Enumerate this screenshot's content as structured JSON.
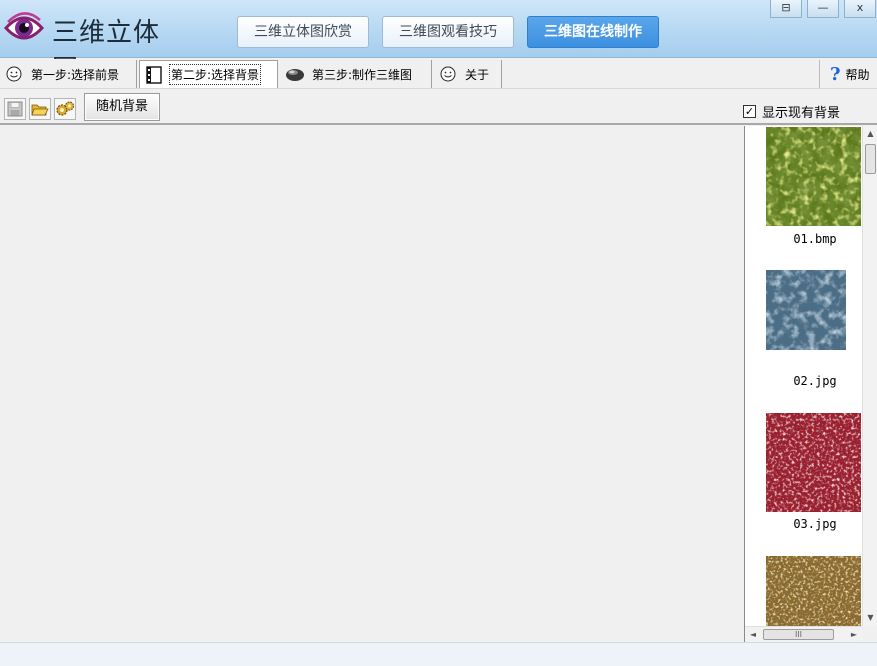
{
  "header": {
    "title": "三维立体图",
    "nav": [
      {
        "label": "三维立体图欣赏",
        "active": false
      },
      {
        "label": "三维图观看技巧",
        "active": false
      },
      {
        "label": "三维图在线制作",
        "active": true
      }
    ],
    "window_controls": {
      "restore": "⊟",
      "minimize": "—",
      "close": "x"
    }
  },
  "tabs": [
    {
      "label": "第一步:选择前景",
      "icon": "smiley-icon"
    },
    {
      "label": "第二步:选择背景",
      "icon": "film-icon",
      "active": true
    },
    {
      "label": "第三步:制作三维图",
      "icon": "stone-icon"
    },
    {
      "label": "关于",
      "icon": "smiley-icon"
    }
  ],
  "help": {
    "label": "帮助",
    "glyph": "?"
  },
  "toolbar": {
    "random_label": "随机背景",
    "show_existing_label": "显示现有背景",
    "show_existing_checked": true,
    "check_glyph": "✓"
  },
  "backgrounds": [
    {
      "filename": "01.bmp",
      "texture": "green-foliage"
    },
    {
      "filename": "02.jpg",
      "texture": "blue-stucco"
    },
    {
      "filename": "03.jpg",
      "texture": "red-glitter"
    },
    {
      "filename": "",
      "texture": "gold-gravel"
    }
  ],
  "scrollbars": {
    "up": "▲",
    "down": "▼",
    "left": "◄",
    "right": "►",
    "grip": "III"
  },
  "colors": {
    "accent": "#3d8fe0",
    "header_bg": "#b6d8f3",
    "help_blue": "#1a66d8"
  }
}
